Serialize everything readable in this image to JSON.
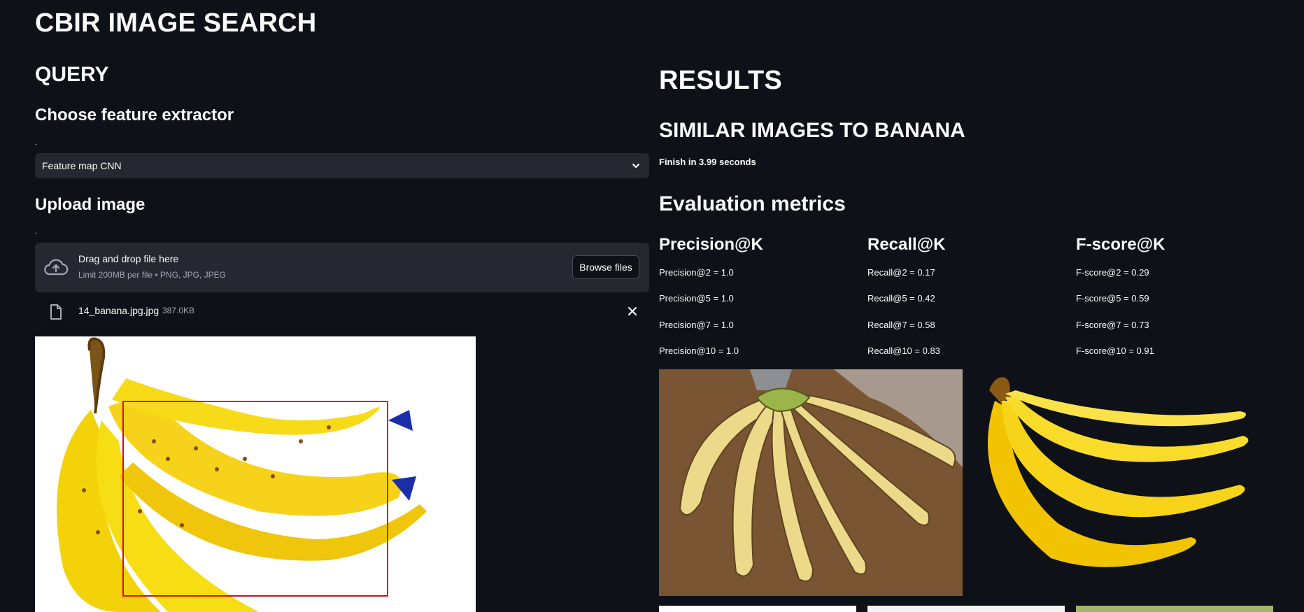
{
  "app": {
    "title": "CBIR IMAGE SEARCH"
  },
  "query": {
    "heading": "QUERY",
    "extractor_heading": "Choose feature extractor",
    "extractor_label": ".",
    "extractor_value": "Feature map CNN",
    "upload_heading": "Upload image",
    "upload_label": ".",
    "dropzone_title": "Drag and drop file here",
    "dropzone_hint": "Limit 200MB per file • PNG, JPG, JPEG",
    "browse_label": "Browse files",
    "file_name": "14_banana.jpg.jpg",
    "file_size": "387.0KB"
  },
  "results": {
    "heading": "RESULTS",
    "subheading": "SIMILAR IMAGES TO BANANA",
    "timing": "Finish in 3.99 seconds",
    "metrics_heading": "Evaluation metrics",
    "metrics": [
      {
        "title": "Precision@K",
        "rows": [
          "Precision@2 = 1.0",
          "Precision@5 = 1.0",
          "Precision@7 = 1.0",
          "Precision@10 = 1.0"
        ]
      },
      {
        "title": "Recall@K",
        "rows": [
          "Recall@2 = 0.17",
          "Recall@5 = 0.42",
          "Recall@7 = 0.58",
          "Recall@10 = 0.83"
        ]
      },
      {
        "title": "F-score@K",
        "rows": [
          "F-score@2 = 0.29",
          "F-score@5 = 0.59",
          "F-score@7 = 0.73",
          "F-score@10 = 0.91"
        ]
      }
    ]
  },
  "colors": {
    "background": "#0e1117",
    "widget": "#262730",
    "banana_yellow": "#f6d21a",
    "bbox_red": "#e30613"
  }
}
